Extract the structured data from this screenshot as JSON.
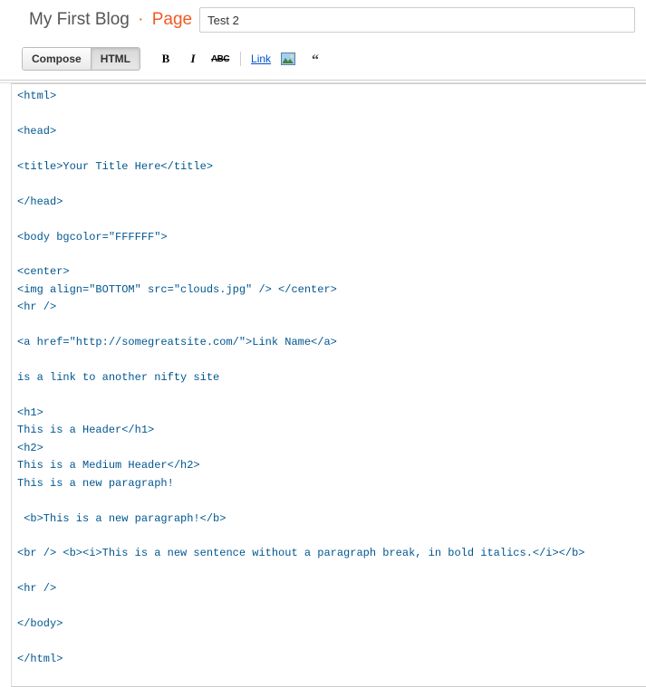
{
  "header": {
    "blog_name": "My First Blog",
    "separator": "·",
    "page_label": "Page",
    "title_value": "Test 2"
  },
  "toolbar": {
    "compose_label": "Compose",
    "html_label": "HTML",
    "link_label": "Link"
  },
  "editor": {
    "content": "<html>\n\n<head>\n\n<title>Your Title Here</title>\n\n</head>\n\n<body bgcolor=\"FFFFFF\">\n\n<center>\n<img align=\"BOTTOM\" src=\"clouds.jpg\" /> </center>\n<hr />\n\n<a href=\"http://somegreatsite.com/\">Link Name</a>\n\nis a link to another nifty site\n\n<h1>\nThis is a Header</h1>\n<h2>\nThis is a Medium Header</h2>\nThis is a new paragraph!\n\n <b>This is a new paragraph!</b>\n\n<br /> <b><i>This is a new sentence without a paragraph break, in bold italics.</i></b>\n\n<hr />\n\n</body>\n\n</html>"
  }
}
